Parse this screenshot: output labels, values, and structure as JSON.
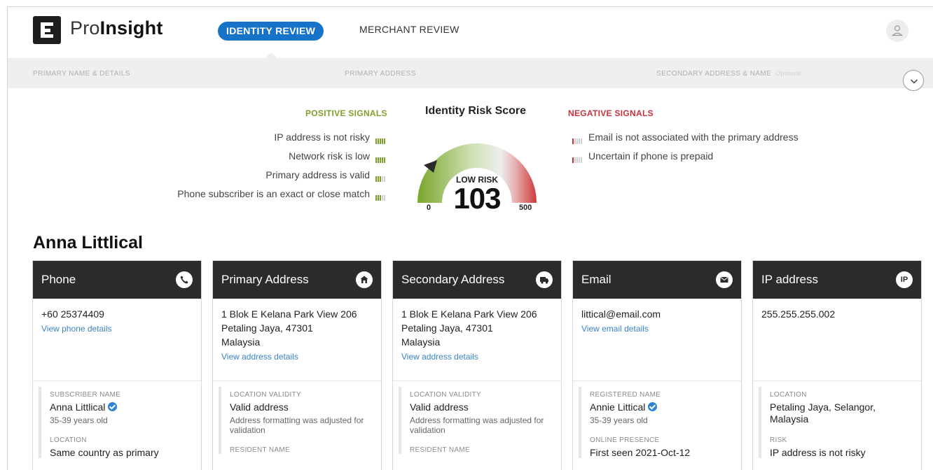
{
  "header": {
    "brand_regular": "Pro",
    "brand_bold": "Insight",
    "tabs": [
      {
        "label": "IDENTITY REVIEW",
        "active": true
      },
      {
        "label": "MERCHANT REVIEW",
        "active": false
      }
    ]
  },
  "steps": {
    "items": [
      {
        "label": "PRIMARY NAME & DETAILS"
      },
      {
        "label": "PRIMARY ADDRESS"
      },
      {
        "label": "SECONDARY ADDRESS & NAME",
        "optional": "Optional"
      }
    ]
  },
  "score": {
    "title": "Identity Risk Score",
    "positive_title": "POSITIVE SIGNALS",
    "negative_title": "NEGATIVE SIGNALS",
    "risk_label": "LOW RISK",
    "value": "103",
    "min": "0",
    "max": "500",
    "positive_signals": [
      {
        "label": "IP address is not risky",
        "level": 5
      },
      {
        "label": "Network risk is low",
        "level": 5
      },
      {
        "label": "Primary address is valid",
        "level": 3
      },
      {
        "label": "Phone subscriber is an exact or close match",
        "level": 3
      }
    ],
    "negative_signals": [
      {
        "label": "Email is not associated with the primary address",
        "level": 1
      },
      {
        "label": "Uncertain if phone is prepaid",
        "level": 1
      }
    ]
  },
  "person": {
    "name": "Anna Littlical"
  },
  "cards": {
    "phone": {
      "title": "Phone",
      "icon": "phone-icon",
      "value": "+60 25374409",
      "link": "View phone details",
      "d1_label": "SUBSCRIBER NAME",
      "d1_value": "Anna Littlical",
      "d1_sub": "35-39 years old",
      "d2_label": "LOCATION",
      "d2_value": "Same country as primary"
    },
    "primary": {
      "title": "Primary Address",
      "icon": "house-icon",
      "line1": "1 Blok E Kelana Park View 206",
      "line2": "Petaling Jaya, 47301",
      "line3": "Malaysia",
      "link": "View address details",
      "d1_label": "LOCATION VALIDITY",
      "d1_value": "Valid address",
      "d1_sub": "Address formatting was adjusted for validation",
      "d2_label": "RESIDENT NAME"
    },
    "secondary": {
      "title": "Secondary Address",
      "icon": "truck-icon",
      "line1": "1 Blok E Kelana Park View 206",
      "line2": "Petaling Jaya, 47301",
      "line3": "Malaysia",
      "link": "View address details",
      "d1_label": "LOCATION VALIDITY",
      "d1_value": "Valid address",
      "d1_sub": "Address formatting was adjusted for validation",
      "d2_label": "RESIDENT NAME"
    },
    "email": {
      "title": "Email",
      "icon": "envelope-icon",
      "value": "littical@email.com",
      "link": "View email details",
      "d1_label": "REGISTERED NAME",
      "d1_value": "Annie Littical",
      "d1_sub": "35-39 years old",
      "d2_label": "ONLINE PRESENCE",
      "d2_value": "First seen 2021-Oct-12"
    },
    "ip": {
      "title": "IP address",
      "icon_text": "IP",
      "value": "255.255.255.002",
      "d1_label": "LOCATION",
      "d1_value": "Petaling Jaya, Selangor, Malaysia",
      "d2_label": "RISK",
      "d2_value": "IP address is not risky"
    }
  }
}
